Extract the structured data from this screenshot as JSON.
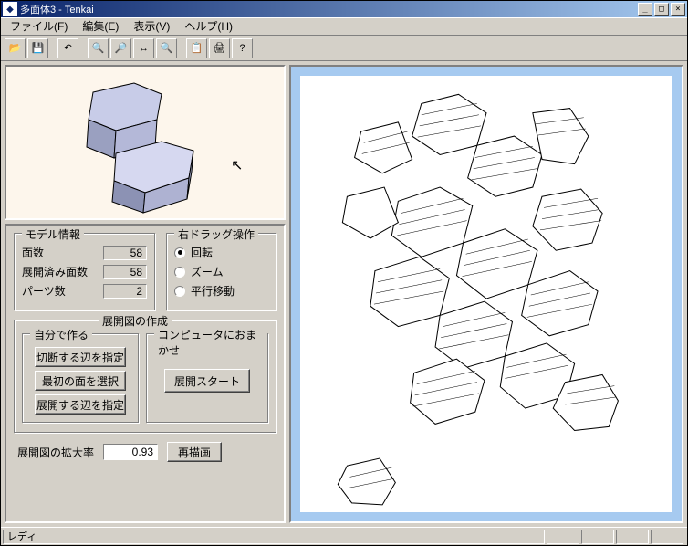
{
  "titlebar": {
    "text": "多面体3 - Tenkai",
    "icon_glyph": "◆"
  },
  "window_controls": {
    "minimize": "_",
    "maximize": "□",
    "close": "×"
  },
  "menubar": {
    "file": "ファイル(F)",
    "edit": "編集(E)",
    "view": "表示(V)",
    "help": "ヘルプ(H)"
  },
  "toolbar_icons": {
    "open": "📂",
    "save": "💾",
    "undo": "↶",
    "zoom_in": "🔍",
    "zoom_out": "🔎",
    "fit": "↔",
    "magnify": "🔍",
    "copy": "📋",
    "print": "🖨",
    "help": "?"
  },
  "model_info": {
    "title": "モデル情報",
    "faces_label": "面数",
    "faces_value": "58",
    "unfolded_label": "展開済み面数",
    "unfolded_value": "58",
    "parts_label": "パーツ数",
    "parts_value": "2"
  },
  "drag_mode": {
    "title": "右ドラッグ操作",
    "rotate": "回転",
    "zoom": "ズーム",
    "pan": "平行移動",
    "selected": "rotate"
  },
  "unfold": {
    "title": "展開図の作成",
    "manual_title": "自分で作る",
    "btn_cut": "切断する辺を指定",
    "btn_first_face": "最初の面を選択",
    "btn_unfold_edge": "展開する辺を指定",
    "auto_title": "コンピュータにおまかせ",
    "btn_start": "展開スタート"
  },
  "scale": {
    "label": "展開図の拡大率",
    "value": "0.93",
    "btn_redraw": "再描画"
  },
  "statusbar": {
    "text": "レディ"
  }
}
